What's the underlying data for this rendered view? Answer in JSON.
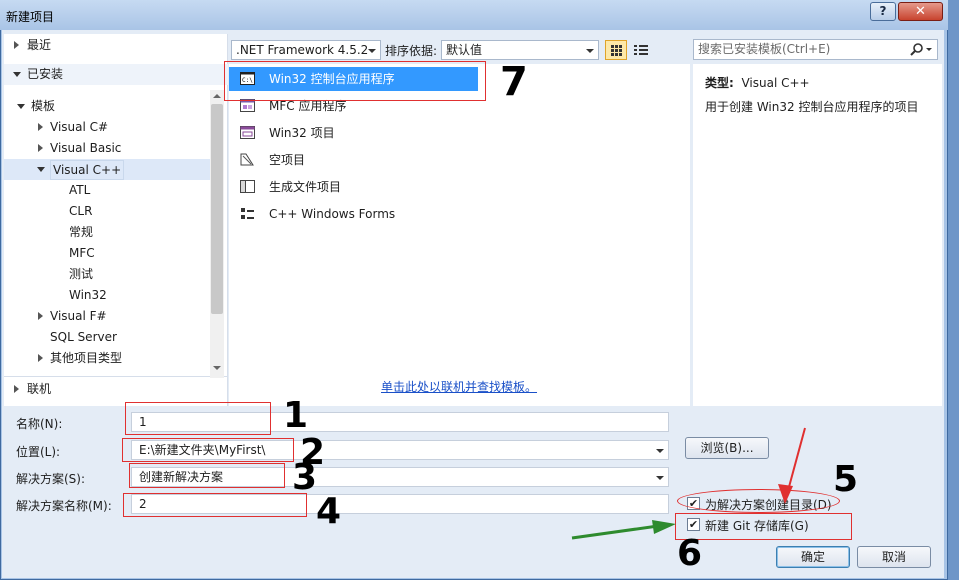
{
  "window": {
    "title": "新建项目",
    "help": "?",
    "close": "✕"
  },
  "tree": {
    "recent": "最近",
    "installed": "已安装",
    "templates": "模板",
    "items": [
      {
        "label": "Visual C#"
      },
      {
        "label": "Visual Basic"
      },
      {
        "label": "Visual C++"
      },
      {
        "label": "ATL"
      },
      {
        "label": "CLR"
      },
      {
        "label": "常规"
      },
      {
        "label": "MFC"
      },
      {
        "label": "测试"
      },
      {
        "label": "Win32"
      },
      {
        "label": "Visual F#"
      },
      {
        "label": "SQL Server"
      },
      {
        "label": "其他项目类型"
      }
    ],
    "online": "联机"
  },
  "toolbar": {
    "framework": ".NET Framework 4.5.2",
    "sort_label": "排序依据:",
    "sort_value": "默认值",
    "search_placeholder": "搜索已安装模板(Ctrl+E)"
  },
  "templates": [
    {
      "label": "Win32 控制台应用程序",
      "icon": "console-app-icon"
    },
    {
      "label": "MFC 应用程序",
      "icon": "mfc-app-icon"
    },
    {
      "label": "Win32 项目",
      "icon": "win32-project-icon"
    },
    {
      "label": "空项目",
      "icon": "empty-project-icon"
    },
    {
      "label": "生成文件项目",
      "icon": "makefile-project-icon"
    },
    {
      "label": "C++ Windows Forms",
      "icon": "windows-forms-icon"
    }
  ],
  "online_link": "单击此处以联机并查找模板。",
  "info": {
    "type_label": "类型:",
    "type_value": "Visual C++",
    "description": "用于创建 Win32 控制台应用程序的项目"
  },
  "form": {
    "name_label": "名称(N):",
    "name_value": "1",
    "location_label": "位置(L):",
    "location_value": "E:\\新建文件夹\\MyFirst\\",
    "solution_label": "解决方案(S):",
    "solution_value": "创建新解决方案",
    "solution_name_label": "解决方案名称(M):",
    "solution_name_value": "2",
    "browse": "浏览(B)...",
    "create_dir": "为解决方案创建目录(D)",
    "create_git": "新建 Git 存储库(G)",
    "ok": "确定",
    "cancel": "取消"
  },
  "annotations": [
    "1",
    "2",
    "3",
    "4",
    "5",
    "6",
    "7"
  ],
  "colors": {
    "selection": "#3399ff",
    "annotation": "#e03030",
    "arrow_green": "#2e8b2e"
  }
}
